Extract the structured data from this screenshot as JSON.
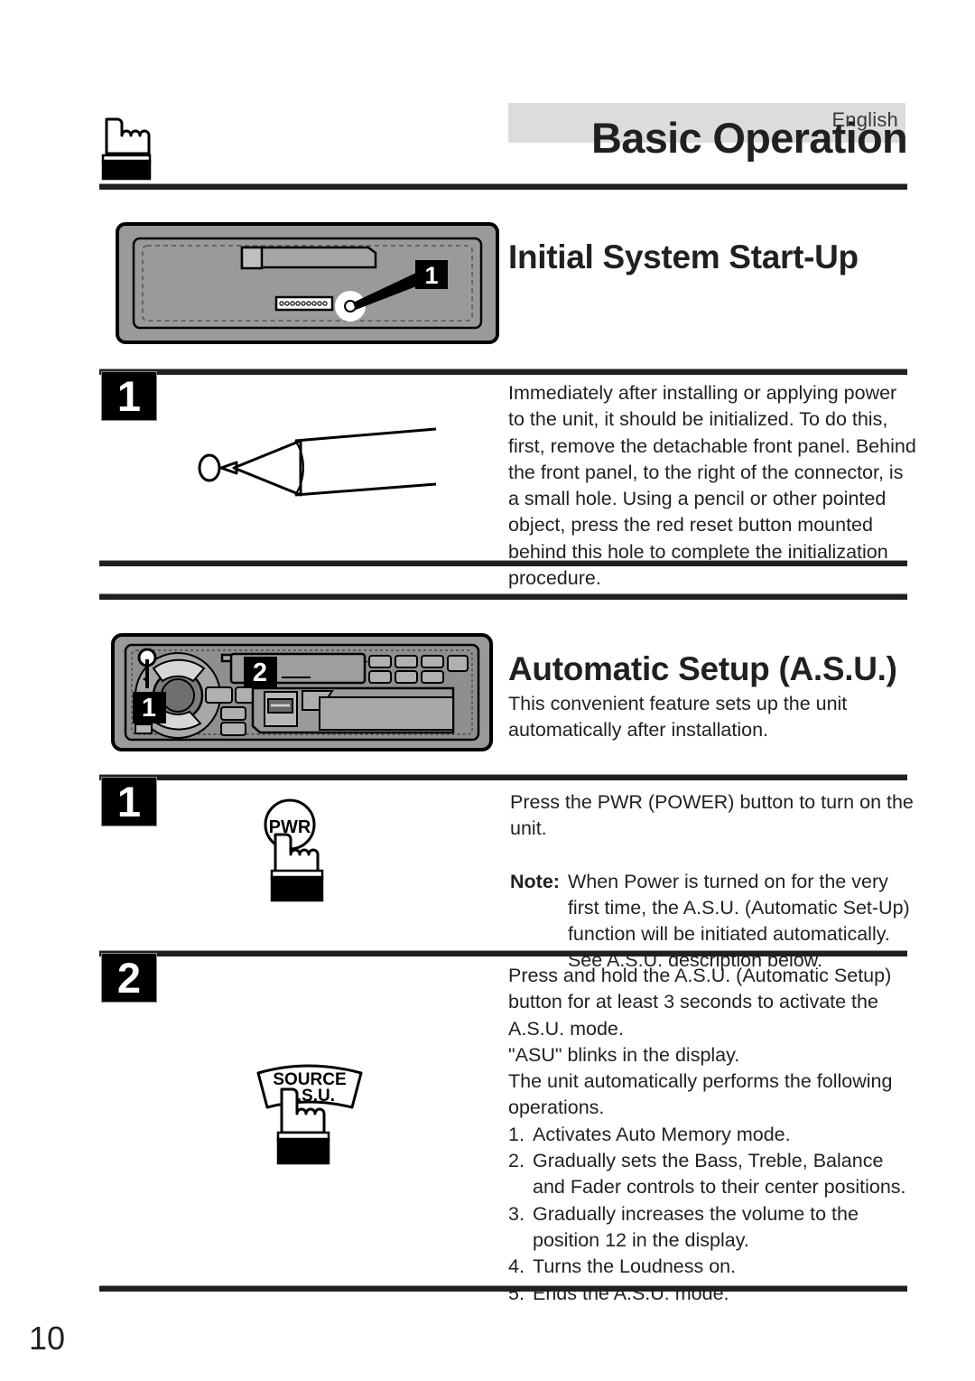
{
  "header": {
    "language": "English",
    "title": "Basic Operation",
    "hand_icon": "pointing-hand-icon"
  },
  "sections": [
    {
      "id": "initial-system-start-up",
      "heading": "Initial System Start-Up",
      "steps": [
        {
          "number": "1",
          "text": "Immediately after installing or applying power to the unit, it should be initialized. To do this, first, remove the detachable front panel. Behind the front panel, to the right of the connector, is a small hole. Using a pencil or other pointed object, press the red reset button mounted behind this hole to complete the initialization procedure."
        }
      ]
    },
    {
      "id": "automatic-setup-asu",
      "heading": "Automatic Setup (A.S.U.)",
      "description": "This convenient feature sets up the unit automatically after installation.",
      "steps": [
        {
          "number": "1",
          "text": "Press the PWR (POWER) button to turn on the unit.",
          "note_label": "Note:",
          "note_text": "When Power is turned on for the very first time, the A.S.U. (Automatic Set-Up) function will be initiated automatically. See A.S.U. description below."
        },
        {
          "number": "2",
          "text": "Press and hold the A.S.U. (Automatic Setup) button for at least 3 seconds to activate the A.S.U. mode.\n\"ASU\" blinks in the display.\nThe unit automatically performs the following operations.",
          "list": [
            {
              "n": "1.",
              "txt": "Activates Auto Memory mode."
            },
            {
              "n": "2.",
              "txt": "Gradually sets the Bass, Treble, Balance and Fader controls to their center positions."
            },
            {
              "n": "3.",
              "txt": "Gradually increases the volume to the position 12 in the display."
            },
            {
              "n": "4.",
              "txt": "Turns the Loudness on."
            },
            {
              "n": "5.",
              "txt": "Ends the A.S.U. mode."
            }
          ]
        }
      ]
    }
  ],
  "illustrations": {
    "chassis": {
      "name": "head-unit-rear-chassis-illustration",
      "callout": "1"
    },
    "pencil": {
      "name": "pencil-pointed-object-illustration"
    },
    "faceplate": {
      "name": "head-unit-front-panel-illustration",
      "callout_power": "1",
      "callout_source": "2"
    },
    "power_button": {
      "name": "pwr-button-press-illustration",
      "label": "PWR"
    },
    "source_button": {
      "name": "source-asu-button-press-illustration",
      "label_top": "SOURCE",
      "label_bottom": "A.S.U."
    }
  },
  "footer": {
    "page_number": "10"
  },
  "colors": {
    "ink": "#231f20",
    "banner_gray": "#dcdcdc",
    "panel_gray": "#9a9a9a",
    "panel_dark": "#6f6f6f"
  }
}
